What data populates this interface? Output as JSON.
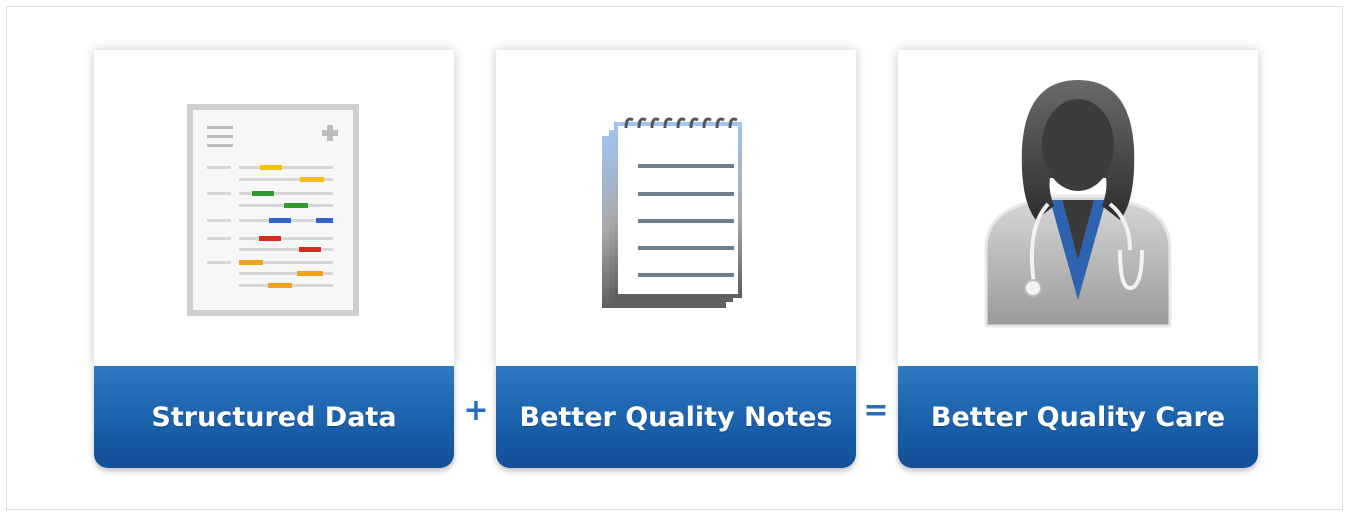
{
  "cards": [
    {
      "label": "Structured Data",
      "icon": "medical-record-icon"
    },
    {
      "label": "Better Quality Notes",
      "icon": "notepad-icon"
    },
    {
      "label": "Better Quality Care",
      "icon": "doctor-icon"
    }
  ],
  "operators": [
    "+",
    "="
  ],
  "colors": {
    "label_blue": "#1c63ad",
    "operator_blue": "#2b6cb8",
    "highlight_yellow": "#f2c200",
    "highlight_green": "#2f9a2f",
    "highlight_blue": "#2d66c8",
    "highlight_red": "#d9281f",
    "highlight_orange": "#f3a21d"
  }
}
